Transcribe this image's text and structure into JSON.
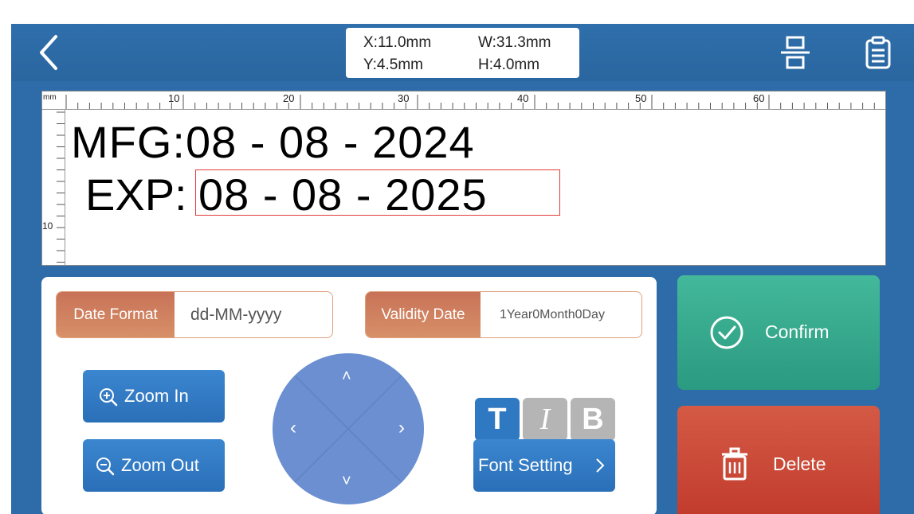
{
  "header": {
    "coords": {
      "x": "X:11.0mm",
      "y": "Y:4.5mm",
      "w": "W:31.3mm",
      "h": "H:4.0mm"
    },
    "icons": [
      "back-arrow-icon",
      "align-center-icon",
      "clipboard-list-icon"
    ]
  },
  "ruler": {
    "unit": "mm",
    "horizontal_labels": [
      "10",
      "20",
      "30",
      "40",
      "50",
      "60"
    ],
    "vertical_labels": [
      "10"
    ]
  },
  "canvas": {
    "mfg_text": "MFG:08 - 08 - 2024",
    "exp_label": "EXP:",
    "exp_value": "08 - 08 - 2025"
  },
  "controls": {
    "date_format": {
      "label": "Date Format",
      "value": "dd-MM-yyyy"
    },
    "validity_date": {
      "label": "Validity Date",
      "value": "1Year0Month0Day"
    },
    "zoom_in_label": "Zoom In",
    "zoom_out_label": "Zoom Out",
    "font_setting_label": "Font Setting",
    "style_buttons": [
      {
        "label": "T",
        "active": true
      },
      {
        "label": "I",
        "active": false
      },
      {
        "label": "B",
        "active": false
      }
    ],
    "dpad_arrows": {
      "up": "˄",
      "down": "˅",
      "left": "‹",
      "right": "›"
    }
  },
  "actions": {
    "confirm_label": "Confirm",
    "delete_label": "Delete"
  },
  "colors": {
    "header_blue": "#2d6ca8",
    "confirm_green": "#2fa88c",
    "delete_red": "#c9483a",
    "field_orange": "#d08060",
    "button_blue": "#2f79c2",
    "dpad_blue": "#6b8fd0",
    "selection_red": "#e23b3b"
  }
}
